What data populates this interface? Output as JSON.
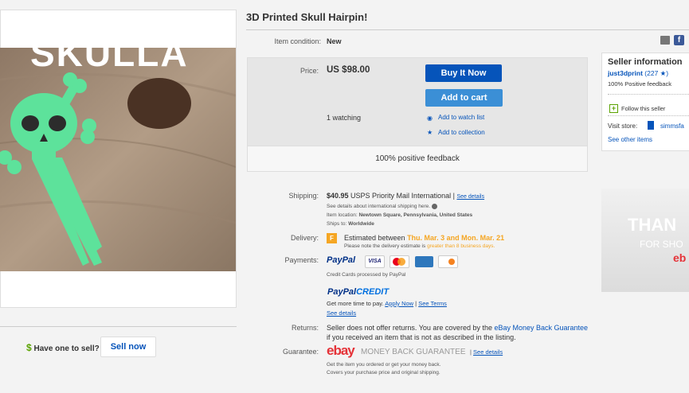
{
  "item": {
    "title": "3D Printed Skull Hairpin!",
    "photo_caption": "SKULLA",
    "condition_label": "Item condition:",
    "condition_value": "New"
  },
  "sell": {
    "dollar": "$",
    "prompt": "Have one to sell?",
    "button": "Sell now"
  },
  "purchase": {
    "price_label": "Price:",
    "price": "US $98.00",
    "buy_now": "Buy It Now",
    "add_to_cart": "Add to cart",
    "watching": "1 watching",
    "watch_list": "Add to watch list",
    "collection": "Add to collection",
    "feedback": "100% positive feedback"
  },
  "shipping": {
    "label": "Shipping:",
    "cost": "$40.95",
    "service": "USPS Priority Mail International",
    "see_details": "See details",
    "intl_note": "See details about international shipping here.",
    "location_label": "Item location:",
    "location": "Newtown Square, Pennsylvania, United States",
    "ships_to_label": "Ships to:",
    "ships_to": "Worldwide"
  },
  "delivery": {
    "label": "Delivery:",
    "estimated": "Estimated between",
    "dates": "Thu. Mar. 3 and Mon. Mar. 21",
    "note_prefix": "Please note the delivery estimate is",
    "note_highlight": "greater than 8 business days."
  },
  "payments": {
    "label": "Payments:",
    "paypal": "PayPal",
    "card_visa": "VISA",
    "processed": "Credit Cards processed by PayPal",
    "paypal_credit_a": "PayPal",
    "paypal_credit_b": "CREDIT",
    "more_time": "Get more time to pay.",
    "apply_now": "Apply Now",
    "see_terms": "See Terms",
    "see_details": "See details"
  },
  "returns": {
    "label": "Returns:",
    "text_prefix": "Seller does not offer returns. You are covered by the",
    "link": "eBay Money Back Guarantee",
    "text_suffix": "if you received an item that is not as described in the listing."
  },
  "guarantee": {
    "label": "Guarantee:",
    "ebay": "ebay",
    "mbg": "MONEY BACK GUARANTEE",
    "see_details": "See details",
    "line1": "Get the item you ordered or get your money back.",
    "line2": "Covers your purchase price and original shipping."
  },
  "seller": {
    "heading": "Seller information",
    "name": "just3dprint",
    "score": "(227 ★)",
    "positive": "100% Positive feedback",
    "follow": "Follow this seller",
    "store_label": "Visit store:",
    "store": "simmsfa",
    "other_items": "See other items"
  },
  "banner": {
    "line1": "THAN",
    "line2": "FOR SHO",
    "brand": "eb"
  },
  "colors": {
    "link": "#0654ba",
    "accent_orange": "#f5a623",
    "skull_green": "#5de29b",
    "photo_wood": "#a48d76"
  }
}
